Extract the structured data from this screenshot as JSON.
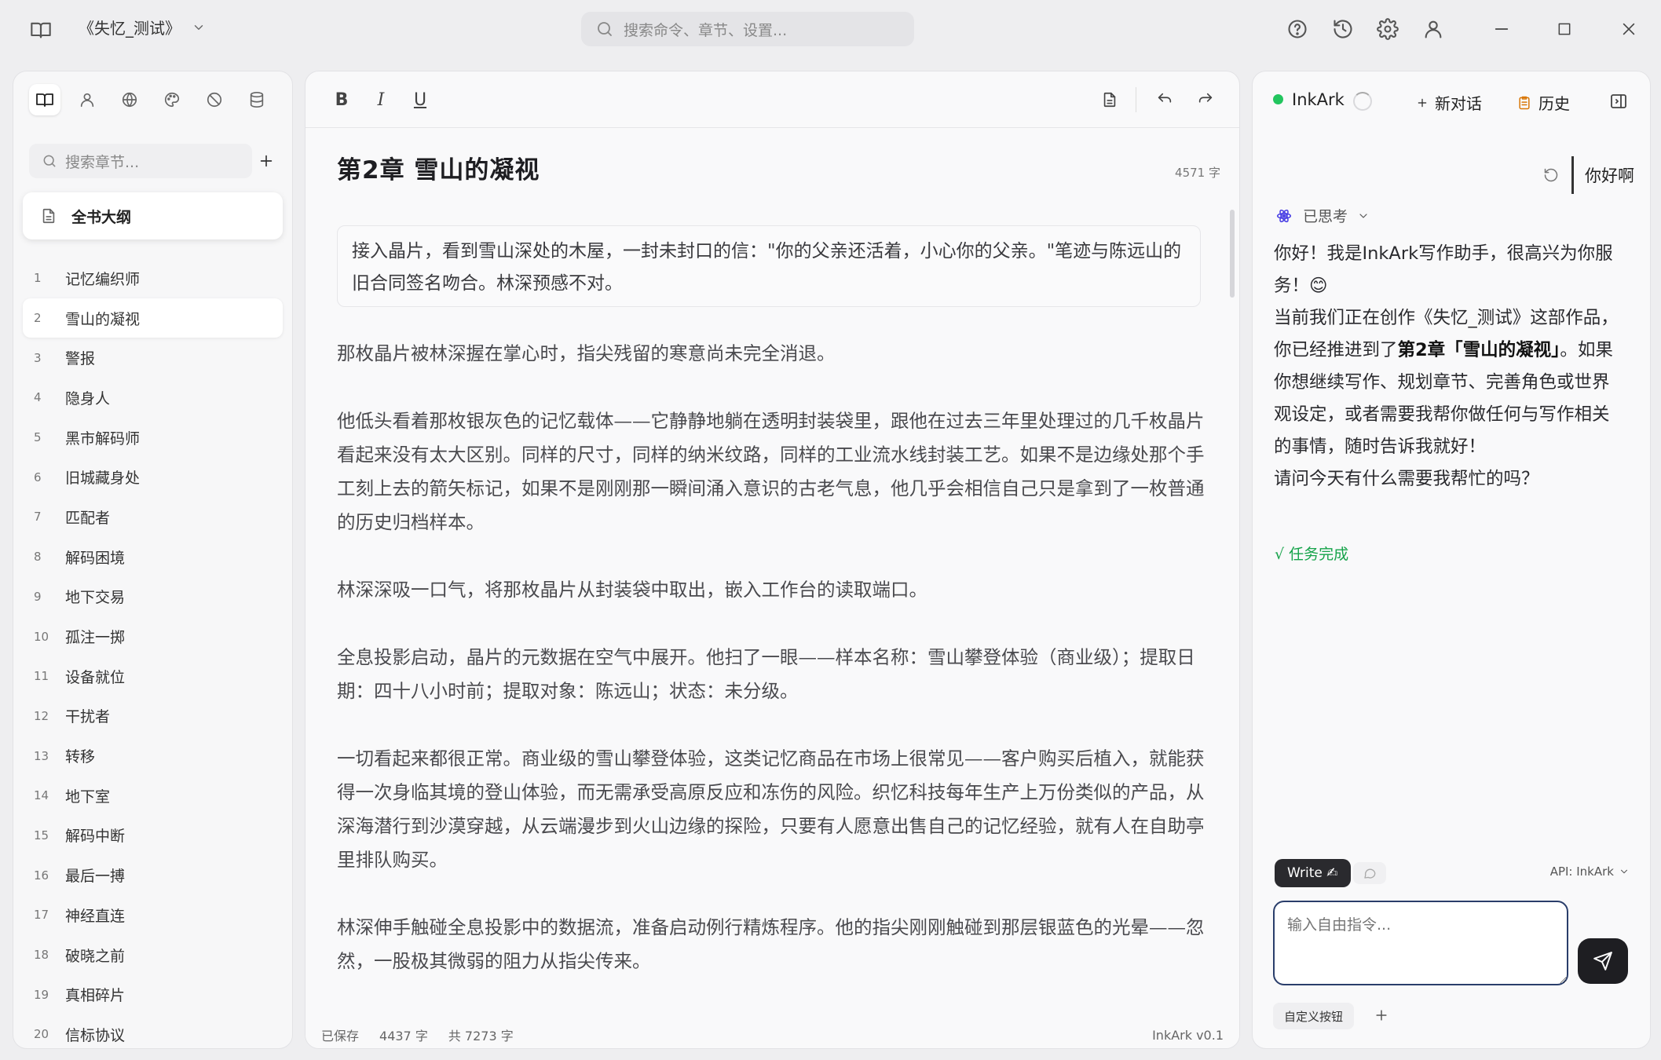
{
  "titlebar": {
    "book_title": "《失忆_测试》",
    "search_placeholder": "搜索命令、章节、设置..."
  },
  "sidebar": {
    "search_placeholder": "搜索章节...",
    "outline_label": "全书大纲",
    "chapters": [
      {
        "num": "1",
        "title": "记忆编织师"
      },
      {
        "num": "2",
        "title": "雪山的凝视"
      },
      {
        "num": "3",
        "title": "警报"
      },
      {
        "num": "4",
        "title": "隐身人"
      },
      {
        "num": "5",
        "title": "黑市解码师"
      },
      {
        "num": "6",
        "title": "旧城藏身处"
      },
      {
        "num": "7",
        "title": "匹配者"
      },
      {
        "num": "8",
        "title": "解码困境"
      },
      {
        "num": "9",
        "title": "地下交易"
      },
      {
        "num": "10",
        "title": "孤注一掷"
      },
      {
        "num": "11",
        "title": "设备就位"
      },
      {
        "num": "12",
        "title": "干扰者"
      },
      {
        "num": "13",
        "title": "转移"
      },
      {
        "num": "14",
        "title": "地下室"
      },
      {
        "num": "15",
        "title": "解码中断"
      },
      {
        "num": "16",
        "title": "最后一搏"
      },
      {
        "num": "17",
        "title": "神经直连"
      },
      {
        "num": "18",
        "title": "破晓之前"
      },
      {
        "num": "19",
        "title": "真相碎片"
      },
      {
        "num": "20",
        "title": "信标协议"
      }
    ]
  },
  "editor": {
    "toolbar": {
      "bold": "B",
      "italic": "I",
      "underline": "U"
    },
    "chapter_title": "第2章  雪山的凝视",
    "word_count_top": "4571 字",
    "summary": "接入晶片，看到雪山深处的木屋，一封未封口的信：\"你的父亲还活着，小心你的父亲。\"笔迹与陈远山的旧合同签名吻合。林深预感不对。",
    "paragraphs": [
      "那枚晶片被林深握在掌心时，指尖残留的寒意尚未完全消退。",
      "他低头看着那枚银灰色的记忆载体——它静静地躺在透明封装袋里，跟他在过去三年里处理过的几千枚晶片看起来没有太大区别。同样的尺寸，同样的纳米纹路，同样的工业流水线封装工艺。如果不是边缘处那个手工刻上去的箭矢标记，如果不是刚刚那一瞬间涌入意识的古老气息，他几乎会相信自己只是拿到了一枚普通的历史归档样本。",
      "林深深吸一口气，将那枚晶片从封装袋中取出，嵌入工作台的读取端口。",
      "全息投影启动，晶片的元数据在空气中展开。他扫了一眼——样本名称：雪山攀登体验（商业级）；提取日期：四十八小时前；提取对象：陈远山；状态：未分级。",
      "一切看起来都很正常。商业级的雪山攀登体验，这类记忆商品在市场上很常见——客户购买后植入，就能获得一次身临其境的登山体验，而无需承受高原反应和冻伤的风险。织忆科技每年生产上万份类似的产品，从深海潜行到沙漠穿越，从云端漫步到火山边缘的探险，只要有人愿意出售自己的记忆经验，就有人在自助亭里排队购买。",
      "林深伸手触碰全息投影中的数据流，准备启动例行精炼程序。他的指尖刚刚触碰到那层银蓝色的光晕——忽然，一股极其微弱的阻力从指尖传来。"
    ],
    "status": {
      "saved": "已保存",
      "chapter_count": "4437 字",
      "total_count": "共 7273 字",
      "version": "InkArk v0.1"
    }
  },
  "chat": {
    "assistant_name": "InkArk",
    "new_chat_label": "新对话",
    "history_label": "历史",
    "user_message": "你好啊",
    "thought_label": "已思考",
    "reply_1": "你好！我是InkArk写作助手，很高兴为你服务！😊",
    "reply_2a": "当前我们正在创作《失忆_测试》这部作品，你已经推进到了",
    "reply_2b": "第2章「雪山的凝视」",
    "reply_2c": "。如果你想继续写作、规划章节、完善角色或世界观设定，或者需要我帮你做任何与写作相关的事情，随时告诉我就好！",
    "reply_3": "请问今天有什么需要我帮忙的吗？",
    "task_done": "√ 任务完成",
    "write_mode": "Write ✍",
    "api_label": "API: InkArk",
    "input_placeholder": "输入自由指令...",
    "custom_button": "自定义按钮"
  }
}
